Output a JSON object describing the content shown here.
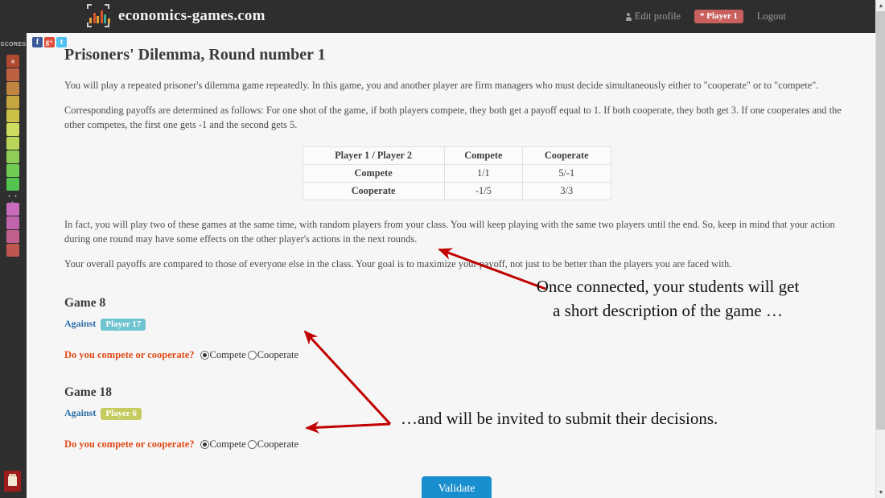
{
  "navbar": {
    "brand": "economics-games.com",
    "logo_icon": "bar-chart-logo-icon",
    "edit_profile": "Edit profile",
    "player_badge": "* Player 1",
    "logout": "Logout"
  },
  "sidebar": {
    "scores_label": "SCORES",
    "dots": "• • •",
    "swatches_top": [
      "#b0492f",
      "#bd6142",
      "#c08540",
      "#c6a63f",
      "#cbc146",
      "#cddc5e",
      "#b8d65a",
      "#8ece57",
      "#6ecb53",
      "#52c44f"
    ],
    "swatches_bottom": [
      "#c76cbd",
      "#c263ad",
      "#c15f8e",
      "#c0574f"
    ],
    "bottom_button_icon": "scores-panel-icon"
  },
  "social": [
    {
      "name": "facebook-icon",
      "glyph": "f",
      "color": "#3b5998"
    },
    {
      "name": "googleplus-icon",
      "glyph": "g+",
      "color": "#dd4b39"
    },
    {
      "name": "twitter-icon",
      "glyph": "t",
      "color": "#4fc0f0"
    }
  ],
  "page": {
    "title": "Prisoners' Dilemma, Round number 1",
    "paragraphs": [
      "You will play a repeated prisoner's dilemma game repeatedly. In this game, you and another player are firm managers who must decide simultaneously either to \"cooperate\" or to \"compete\".",
      "Corresponding payoffs are determined as follows: For one shot of the game, if both players compete, they both get a payoff equal to 1. If both cooperate, they both get 3. If one cooperates and the other competes, the first one gets -1 and the second gets 5.",
      "In fact, you will play two of these games at the same time, with random players from your class. You will keep playing with the same two players until the end. So, keep in mind that your action during one round may have some effects on the other player's actions in the next rounds.",
      "Your overall payoffs are compared to those of everyone else in the class. Your goal is to maximize your payoff, not just to be better than the players you are faced with."
    ]
  },
  "payoff_table": {
    "headers": [
      "Player 1 / Player 2",
      "Compete",
      "Cooperate"
    ],
    "rows": [
      {
        "label": "Compete",
        "cells": [
          "1/1",
          "5/-1"
        ]
      },
      {
        "label": "Cooperate",
        "cells": [
          "-1/5",
          "3/3"
        ]
      }
    ]
  },
  "games": [
    {
      "title": "Game 8",
      "against_label": "Against",
      "opponent": "Player 17",
      "opponent_color": "#6ec4d0",
      "question": "Do you compete or cooperate?",
      "options": [
        {
          "label": "Compete",
          "selected": true
        },
        {
          "label": "Cooperate",
          "selected": false
        }
      ]
    },
    {
      "title": "Game 18",
      "against_label": "Against",
      "opponent": "Player 6",
      "opponent_color": "#c6cb5f",
      "question": "Do you compete or cooperate?",
      "options": [
        {
          "label": "Compete",
          "selected": true
        },
        {
          "label": "Cooperate",
          "selected": false
        }
      ]
    }
  ],
  "validate_button": "Validate",
  "annotations": {
    "arrow_color": "#c00000",
    "note_1": "Once connected, your students will get a short description of the game …",
    "note_2": "…and will be invited to submit their decisions."
  },
  "scrollbar": {
    "up_arrow": "▲",
    "down_arrow": "▼"
  }
}
